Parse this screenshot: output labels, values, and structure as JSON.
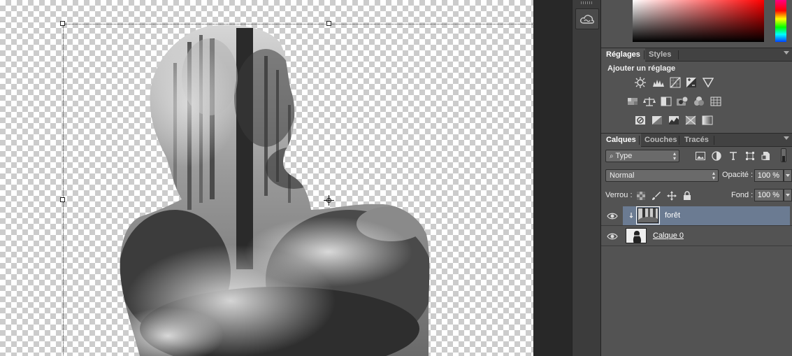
{
  "panels": {
    "adjustments_tabs": [
      "Réglages",
      "Styles"
    ],
    "adjustments_title": "Ajouter un réglage",
    "adjustment_icons_row1": [
      "brightness-contrast-icon",
      "levels-icon",
      "curves-icon",
      "exposure-icon",
      "vibrance-icon"
    ],
    "adjustment_icons_row2": [
      "hue-saturation-icon",
      "color-balance-icon",
      "black-white-icon",
      "photo-filter-icon",
      "channel-mixer-icon",
      "color-lookup-icon"
    ],
    "adjustment_icons_row3": [
      "invert-icon",
      "posterize-icon",
      "threshold-icon",
      "selective-color-icon",
      "gradient-map-icon"
    ],
    "layers_tabs": [
      "Calques",
      "Couches",
      "Tracés"
    ],
    "filter_kind": "Type",
    "blend_mode": "Normal",
    "opacity_label": "Opacité :",
    "opacity_value": "100 %",
    "lock_label": "Verrou :",
    "fill_label": "Fond :",
    "fill_value": "100 %",
    "layers": [
      {
        "name": "forêt",
        "selected": true,
        "clipped": true
      },
      {
        "name": "Calque 0",
        "selected": false,
        "clipped": false
      }
    ]
  },
  "colors": {
    "panel_bg": "#535353",
    "selected_layer": "#6b7b92"
  }
}
